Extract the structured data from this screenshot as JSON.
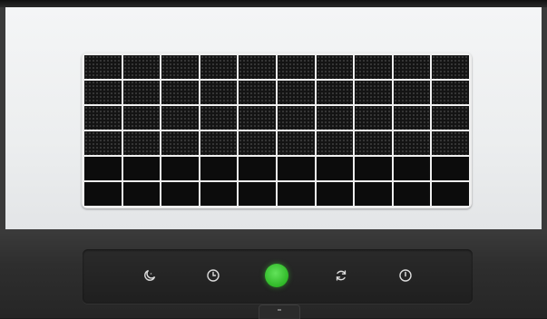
{
  "device": {
    "type": "air-purifier",
    "front_color": "#eceeef",
    "base_color": "#2e2e2e",
    "grille": {
      "columns": 10,
      "mesh_rows": 4,
      "solid_rows": 2
    }
  },
  "controls": [
    {
      "id": "sleep",
      "icon": "moon-sleep-icon",
      "indicator_color": ""
    },
    {
      "id": "timer",
      "icon": "clock-icon",
      "indicator_color": ""
    },
    {
      "id": "status",
      "icon": "green-status-indicator",
      "indicator_color": "#35c72c"
    },
    {
      "id": "auto",
      "icon": "auto-cycle-icon",
      "indicator_color": ""
    },
    {
      "id": "power",
      "icon": "power-icon",
      "indicator_color": ""
    }
  ]
}
